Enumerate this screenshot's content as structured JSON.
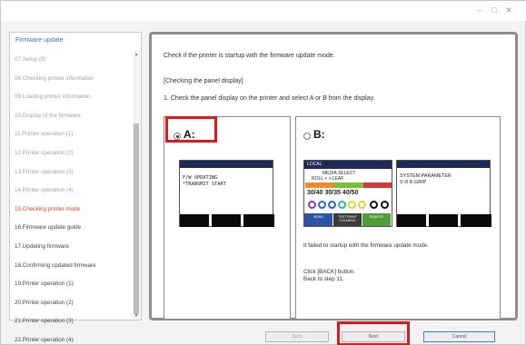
{
  "window": {
    "controls": {
      "minimize": "–",
      "maximize": "□",
      "close": "✕"
    }
  },
  "sidebar": {
    "title": "Firmware update",
    "items": [
      {
        "label": "07.Setup (8)",
        "state": "done"
      },
      {
        "label": "08.Checking printer information",
        "state": "done"
      },
      {
        "label": "09.Loading printer information",
        "state": "done"
      },
      {
        "label": "10.Display of the firmware",
        "state": "done"
      },
      {
        "label": "11.Printer operation (1)",
        "state": "done"
      },
      {
        "label": "12.Printer operation (2)",
        "state": "done"
      },
      {
        "label": "13.Printer operation (3)",
        "state": "done"
      },
      {
        "label": "14.Printer operation (4)",
        "state": "done"
      },
      {
        "label": "15.Checking printer mode",
        "state": "active"
      },
      {
        "label": "16.Firmware update guide",
        "state": "future"
      },
      {
        "label": "17.Updating firmware",
        "state": "future"
      },
      {
        "label": "18.Confirming updated firmware",
        "state": "future"
      },
      {
        "label": "19.Printer operation (1)",
        "state": "future"
      },
      {
        "label": "20.Printer operation (2)",
        "state": "future"
      },
      {
        "label": "21.Printer operation (3)",
        "state": "future"
      },
      {
        "label": "22.Printer operation (4)",
        "state": "future"
      }
    ],
    "scroll_up": "▲",
    "scroll_down": "▼"
  },
  "main": {
    "instruction": "Check if the printer is startup with the firmware update mode.",
    "section_heading": "[Checking the panel display]",
    "step": "1.  Check the panel display on the printer and select A or B from the display.",
    "option_a": {
      "label": "A:",
      "selected": true,
      "display_line1": "F/W UPDATING",
      "display_line2": "*TRANSMIT START"
    },
    "option_b": {
      "label": "B:",
      "selected": false,
      "display1": {
        "header": "LOCAL",
        "media_select": "MEDIA SELECT",
        "roll_leaf": "ROLL  <          >  LEAF",
        "values": "30/40  30/35  40/50",
        "softkeys": [
          "MENU",
          "TEST PRINT CLEANING",
          "REMOTE"
        ]
      },
      "display2": {
        "line1": "SYSTEM PARAMETER",
        "line2": "0~8          R.GRIP"
      },
      "description": "It failed to startup with the firmware update mode.",
      "back_line1": "Click [BACK] button.",
      "back_line2": "Back to step 11."
    }
  },
  "footer": {
    "back_label": "Back",
    "next_label": "Next",
    "cancel_label": "Cancel"
  },
  "colors": {
    "active_step": "#e53a2f",
    "highlight": "#e0171b",
    "display_header": "#1e2a55",
    "title_link": "#3f6fb5"
  }
}
